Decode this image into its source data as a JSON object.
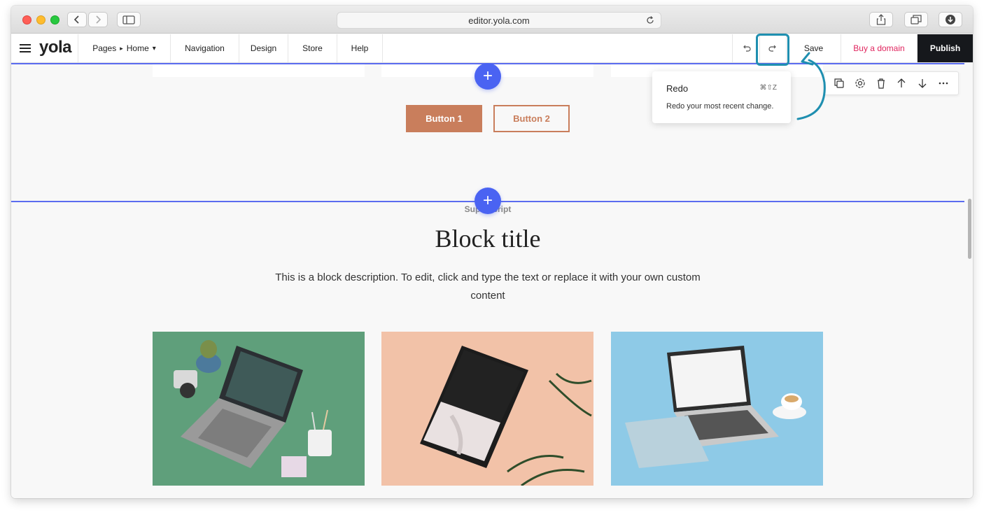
{
  "browser": {
    "url": "editor.yola.com"
  },
  "toolbar": {
    "logo": "yola",
    "pages_label": "Pages",
    "page_sep": "▸",
    "home_label": "Home",
    "home_chevron": "▾",
    "navigation": "Navigation",
    "design": "Design",
    "store": "Store",
    "help": "Help",
    "save": "Save",
    "buy_domain": "Buy a domain",
    "publish": "Publish"
  },
  "tooltip": {
    "title": "Redo",
    "shortcut": "⌘⇧Z",
    "description": "Redo your most recent change."
  },
  "block_toolbar": {
    "icons": [
      "duplicate-icon",
      "settings-icon",
      "delete-icon",
      "move-up-icon",
      "move-down-icon",
      "more-icon"
    ]
  },
  "canvas": {
    "add_symbol": "+",
    "button1": "Button 1",
    "button2": "Button 2",
    "superscript": "Superscript",
    "block_title": "Block title",
    "block_description": "This is a block description. To edit, click and type the text or replace it with your own custom content"
  },
  "colors": {
    "accent_blue": "#4a63f2",
    "button_brown": "#c97e5c",
    "highlight": "#1f8fb0",
    "buy_domain": "#e0245e",
    "publish_bg": "#16181c"
  }
}
